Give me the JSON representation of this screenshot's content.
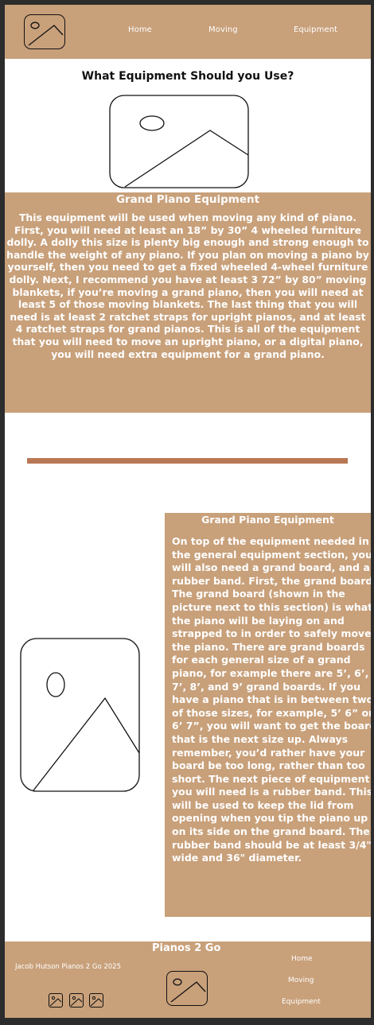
{
  "nav": {
    "logo_icon": "image-placeholder-icon",
    "links": [
      "Home",
      "Moving",
      "Equipment"
    ]
  },
  "main": {
    "heading": "What Equipment Should you Use?",
    "hero_image_icon": "image-placeholder-icon",
    "section1": {
      "title": "Grand Piano Equipment",
      "body": "This equipment will be used when moving any kind of piano. First, you will need at least an 18” by 30” 4 wheeled furniture dolly. A dolly this size is plenty big enough and strong enough to handle the weight of any piano. If you plan on moving a piano by yourself, then you need to get a fixed wheeled 4-wheel furniture dolly. Next, I recommend you have at least 3 72” by 80” moving blankets, if you’re moving a grand piano, then you will need at least 5 of those moving blankets. The last thing that you will need is at least 2 ratchet straps for upright pianos, and at least 4 ratchet straps for grand pianos. This is all of the equipment that you will need to move an upright piano, or a digital piano, you will need extra equipment for a grand piano."
    },
    "section2": {
      "title": "Grand Piano Equipment",
      "body": "On top of the equipment needed in the general equipment section, you will also need a grand board, and a rubber band. First, the grand board. The grand board (shown in the picture next to this section) is what the piano will be laying on and strapped to in order to safely move the piano. There are grand boards for each general size of a grand piano, for example there are 5’, 6’, 7’, 8’, and 9’ grand boards. If you have a piano that is in between two of those sizes, for example, 5’ 6” or 6’ 7”, you will want to get the board that is the next size up. Always remember, you’d rather have your board be too long, rather than too short. The next piece of equipment you will need is a rubber band. This will be used to keep the lid from opening when you tip the piano up on its side on the grand board. The rubber band should be at least 3/4\" wide and 36\" diameter."
    }
  },
  "footer": {
    "brand": "Pianos 2 Go",
    "copyright": "Jacob Hutson Pianos 2 Go 2025",
    "links": [
      "Home",
      "Moving",
      "Equipment"
    ]
  },
  "colors": {
    "tan": "#c8a07a",
    "divider": "#b97855",
    "background": "#2c2c2c"
  }
}
